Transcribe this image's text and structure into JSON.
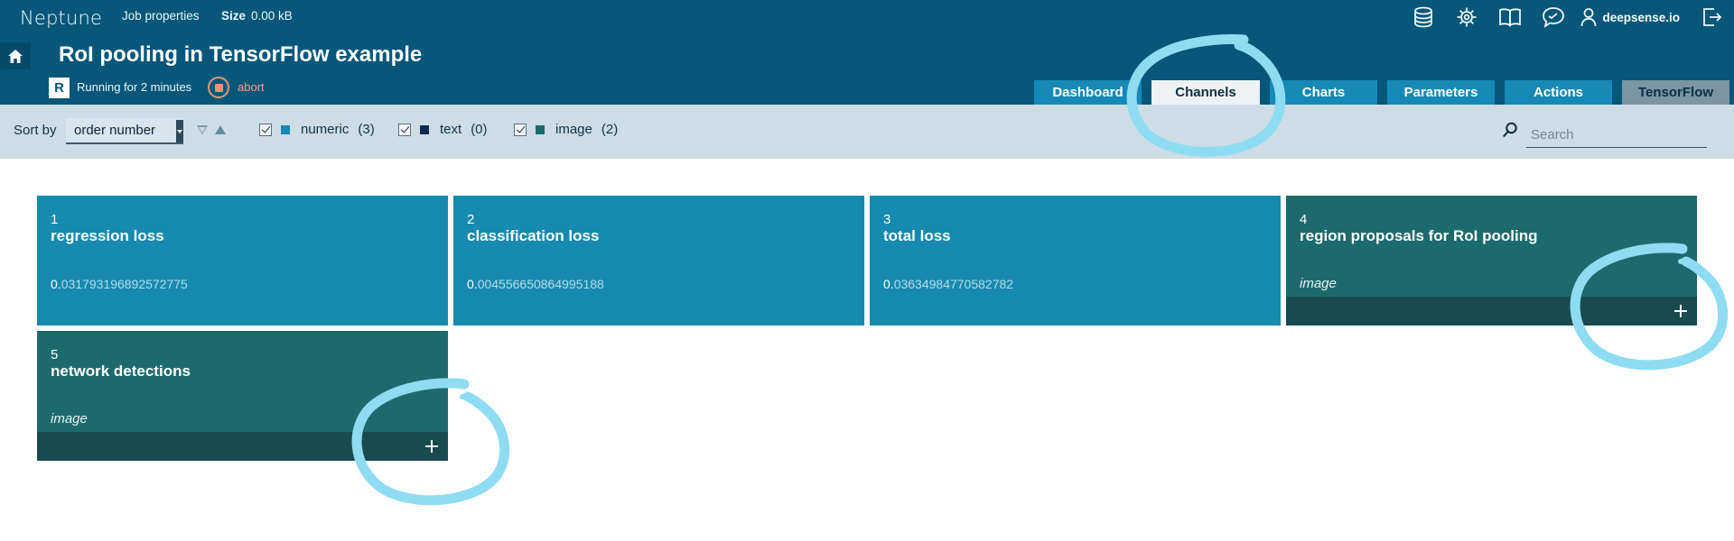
{
  "header": {
    "logo": "Neptune",
    "job_properties": "Job properties",
    "size_label": "Size",
    "size_value": "0.00 kB",
    "title": "RoI pooling in TensorFlow example",
    "status_badge": "R",
    "status_text": "Running for 2 minutes",
    "abort_label": "abort",
    "user_name": "deepsense.io",
    "icons": [
      "database-icon",
      "settings-icon",
      "book-icon",
      "chat-icon",
      "user-icon",
      "logout-icon"
    ]
  },
  "tabs": [
    {
      "label": "Dashboard",
      "state": "normal"
    },
    {
      "label": "Channels",
      "state": "active"
    },
    {
      "label": "Charts",
      "state": "normal"
    },
    {
      "label": "Parameters",
      "state": "normal"
    },
    {
      "label": "Actions",
      "state": "normal"
    },
    {
      "label": "TensorFlow",
      "state": "disabled"
    }
  ],
  "toolbar": {
    "sort_label": "Sort by",
    "sort_value": "order number",
    "filters": [
      {
        "label": "numeric",
        "count": "(3)",
        "checked": true,
        "color": "#1689b6"
      },
      {
        "label": "text",
        "count": "(0)",
        "checked": true,
        "color": "#0f2a52"
      },
      {
        "label": "image",
        "count": "(2)",
        "checked": true,
        "color": "#1d6a6e"
      }
    ],
    "search_placeholder": "Search"
  },
  "channels": [
    {
      "num": "1",
      "name": "regression loss",
      "kind": "numeric",
      "value_lead": "0.",
      "value_rest": "031793196892572775"
    },
    {
      "num": "2",
      "name": "classification loss",
      "kind": "numeric",
      "value_lead": "0.",
      "value_rest": "004556650864995188"
    },
    {
      "num": "3",
      "name": "total loss",
      "kind": "numeric",
      "value_lead": "0.",
      "value_rest": "03634984770582782"
    },
    {
      "num": "4",
      "name": "region proposals for RoI pooling",
      "kind": "image",
      "type_label": "image"
    },
    {
      "num": "5",
      "name": "network detections",
      "kind": "image",
      "type_label": "image"
    }
  ],
  "colors": {
    "header_bg": "#06577a",
    "tab_bg": "#1689b6",
    "toolbar_bg": "#cddde5",
    "numeric_card": "#168aaf",
    "image_card": "#1d6a6e",
    "image_footer": "#174b50",
    "abort": "#e7957b",
    "highlight": "#8edcf2"
  }
}
